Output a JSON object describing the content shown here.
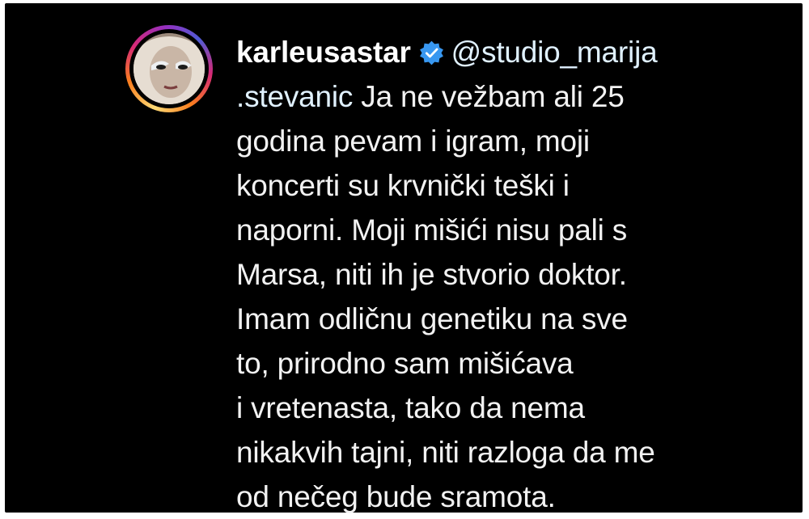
{
  "comment": {
    "username": "karleusastar",
    "verified_icon": "verified-badge-icon",
    "mention_part1": "@studio_marija",
    "mention_part2": ".stevanic",
    "lines": [
      " Ja ne vežbam ali 25",
      "godina pevam i igram, moji",
      "koncerti su krvnički teški i",
      "naporni. Moji mišići nisu pali s",
      "Marsa, niti ih je stvorio doktor.",
      "Imam odličnu genetiku na sve",
      "to, prirodno sam mišićava",
      "i vretenasta, tako da nema",
      "nikakvih tajni, niti razloga da me",
      "od nečeg bude sramota."
    ]
  },
  "colors": {
    "background": "#000000",
    "text": "#f2f2f2",
    "verified_blue": "#3897f0"
  }
}
